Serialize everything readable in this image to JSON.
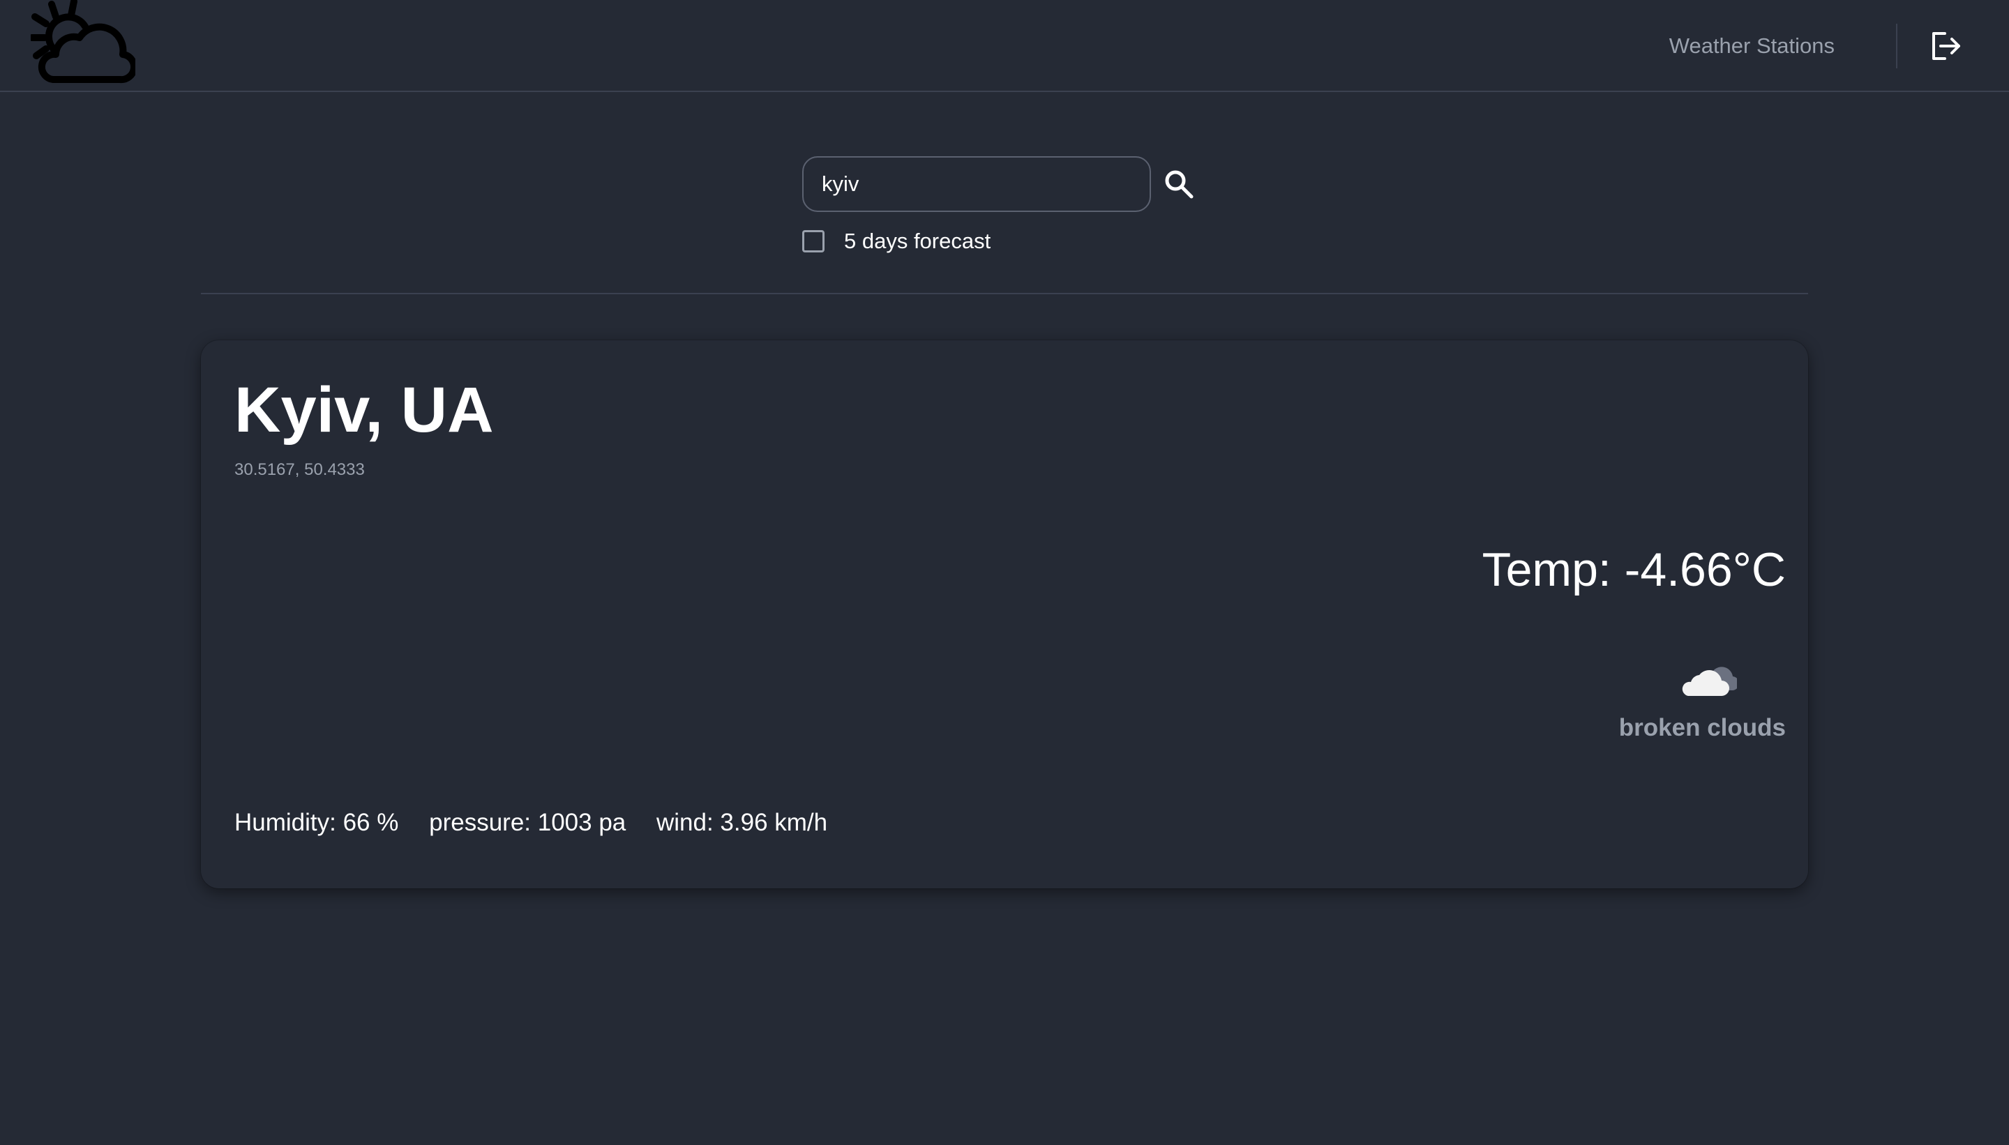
{
  "navbar": {
    "logo_icon": "sun-behind-cloud-icon",
    "nav_link_label": "Weather Stations",
    "logout_icon": "logout-icon"
  },
  "search": {
    "value": "kyiv",
    "button_icon": "search-icon",
    "forecast_checkbox_checked": false,
    "forecast_label": "5 days forecast"
  },
  "weather": {
    "city": "Kyiv, UA",
    "coordinates": "30.5167, 50.4333",
    "temp_label": "Temp:",
    "temp_value": "-4.66°C",
    "icon": "broken-clouds-icon",
    "description": "broken clouds",
    "humidity": "Humidity: 66 %",
    "pressure": "pressure: 1003 pa",
    "wind": "wind: 3.96 km/h"
  },
  "colors": {
    "background": "#252a35",
    "border": "#3b4150",
    "muted_text": "#9aa1ad",
    "text": "#ffffff"
  }
}
